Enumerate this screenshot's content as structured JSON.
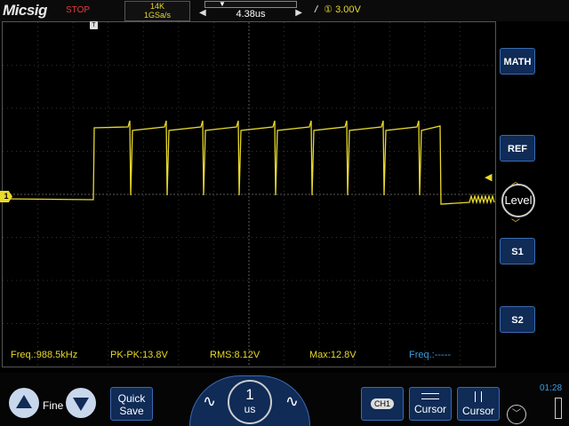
{
  "header": {
    "brand": "Micsig",
    "status": "STOP",
    "memory_depth": "14K",
    "sample_rate": "1GSa/s",
    "horizontal_offset": "4.38us",
    "trigger_level": "3.00V",
    "trigger_channel_glyph": "①"
  },
  "channel": {
    "marker": "1",
    "color": "#e8d92c"
  },
  "measurements": [
    {
      "label": "Freq.:988.5kHz",
      "color": "#e8d92c"
    },
    {
      "label": "PK-PK:13.8V",
      "color": "#e8d92c"
    },
    {
      "label": "RMS:8.12V",
      "color": "#e8d92c"
    },
    {
      "label": "Max:12.8V",
      "color": "#e8d92c"
    },
    {
      "label": "Freq.:-----",
      "color": "#3b9de0"
    }
  ],
  "side_buttons": {
    "math": "MATH",
    "ref": "REF",
    "level": "Level",
    "s1": "S1",
    "s2": "S2"
  },
  "bottom": {
    "fine_label": "Fine",
    "quick_save": [
      "Quick",
      "Save"
    ],
    "timebase_value": "1",
    "timebase_unit": "us",
    "ch_label": "CH1",
    "cursor1": "Cursor",
    "cursor2": "Cursor",
    "clock": "01:28"
  },
  "icons": [
    "up-arrow-icon",
    "down-arrow-icon",
    "sine-wave-icon",
    "trigger-edge-icon",
    "chevron-icon",
    "battery-icon"
  ]
}
